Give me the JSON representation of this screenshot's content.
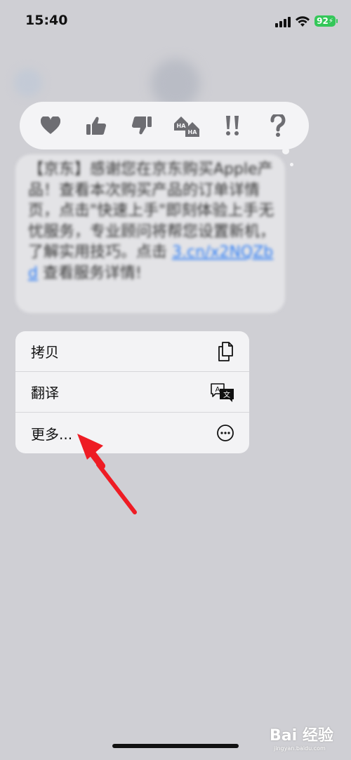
{
  "status_bar": {
    "time": "15:40",
    "battery": "92"
  },
  "tapbacks": [
    {
      "icon": "heart-icon"
    },
    {
      "icon": "thumbs-up-icon"
    },
    {
      "icon": "thumbs-down-icon"
    },
    {
      "icon": "haha-icon"
    },
    {
      "icon": "exclamation-icon"
    },
    {
      "icon": "question-icon"
    }
  ],
  "message": {
    "text": "【京东】感谢您在京东购买Apple产品！查看本次购买产品的订单详情页，点击\"快速上手\"即刻体验上手无忧服务，专业顾问将帮您设置新机，了解实用技巧。点击 ",
    "link": "3.cn/x2NQZbd",
    "text_after": " 查看服务详情!"
  },
  "context_menu": {
    "items": [
      {
        "label": "拷贝",
        "icon": "copy-icon"
      },
      {
        "label": "翻译",
        "icon": "translate-icon"
      },
      {
        "label": "更多...",
        "icon": "more-icon"
      }
    ]
  },
  "watermark": {
    "main": "Bai 经验",
    "sub": "jingyan.baidu.com"
  },
  "colors": {
    "accent_link": "#2b7cf6",
    "battery": "#34c759",
    "arrow": "#ee1c24"
  }
}
